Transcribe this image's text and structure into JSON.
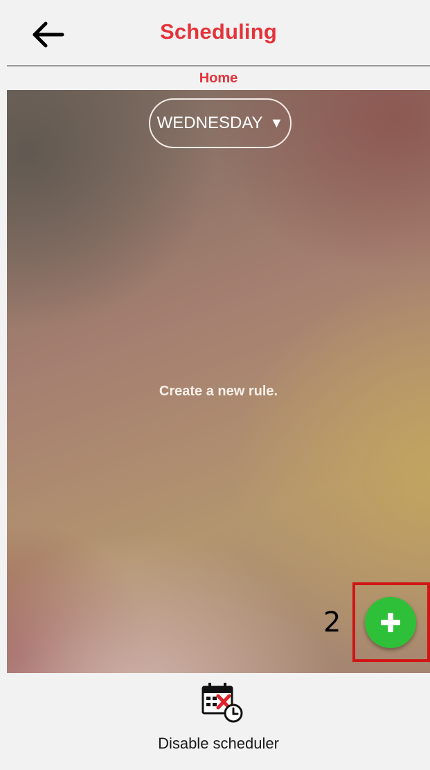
{
  "header": {
    "title": "Scheduling",
    "back_icon": "arrow-left-icon"
  },
  "subtitle": "Home",
  "day_selector": {
    "value": "WEDNESDAY",
    "caret": "▼"
  },
  "empty_message": "Create a new rule.",
  "annotation": {
    "step_number": "2"
  },
  "fab": {
    "icon": "plus-icon",
    "color": "#2fc03a"
  },
  "bottom": {
    "disable_label": "Disable scheduler",
    "icon": "calendar-disabled-icon"
  },
  "colors": {
    "accent": "#e5333a",
    "highlight": "#d01515"
  }
}
